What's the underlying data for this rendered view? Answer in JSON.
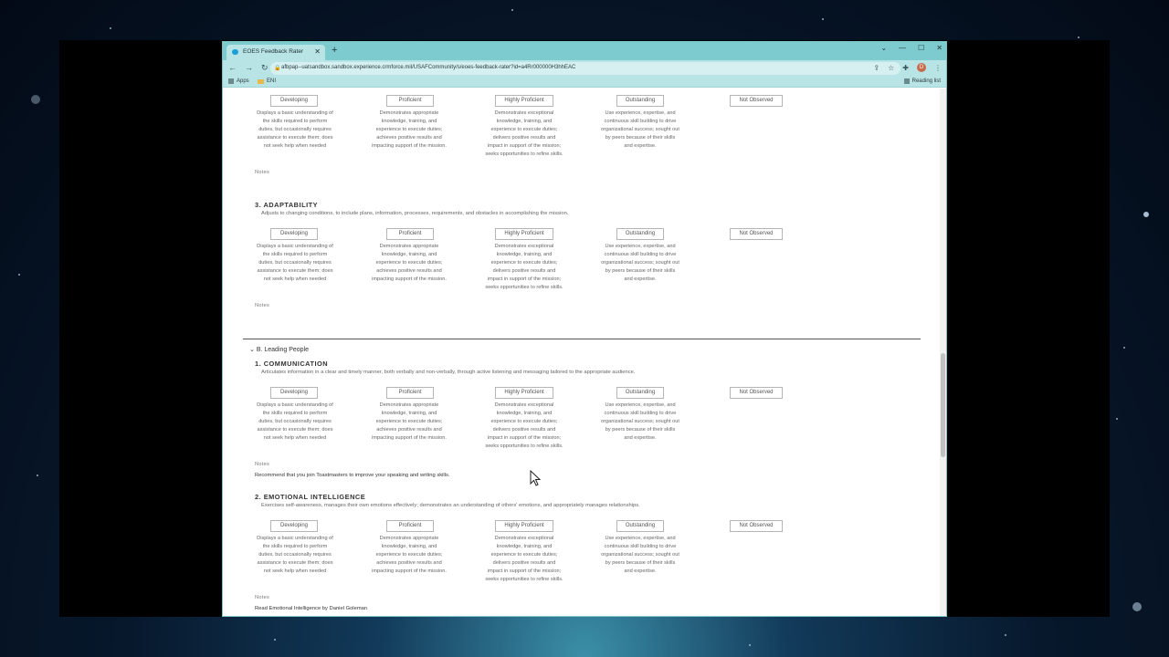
{
  "browser": {
    "tab_title": "EOES Feedback Rater",
    "url": "afbpap--uatsandbox.sandbox.experience.crmforce.mil/USAFCommunity/s/eoes-feedback-rater?id=a4Rr000000H3hhEAC",
    "bookmarks": [
      "Apps",
      "ENI"
    ],
    "reading_list": "Reading list",
    "avatar_letter": "D"
  },
  "rating_options": [
    "Developing",
    "Proficient",
    "Highly Proficient",
    "Outstanding",
    "Not Observed"
  ],
  "rating_descriptions": [
    "Displays a basic understanding of the skills required to perform duties, but occasionally requires assistance to execute them; does not seek help when needed",
    "Demonstrates appropriate knowledge, training, and experience to execute duties; achieves positive results and impacting support of the mission.",
    "Demonstrates exceptional knowledge, training, and experience to execute duties; delivers positive results and impact in support of the mission; seeks opportunities to refine skills.",
    "Use experience, expertise, and continuous skill building to drive organizational success; sought out by peers because of their skills and expertise."
  ],
  "notes_label": "Notes",
  "adaptability": {
    "title": "3. ADAPTABILITY",
    "description": "Adjusts to changing conditions, to include plans, information, processes, requirements, and obstacles in accomplishing the mission."
  },
  "section_b": {
    "title": "B. Leading People",
    "communication": {
      "title": "1. COMMUNICATION",
      "description": "Articulates information in a clear and timely manner, both verbally and non-verbally, through active listening and messaging tailored to the appropriate audience.",
      "note": "Recommend that you join Toastmasters to improve your speaking and writing skills."
    },
    "emotional": {
      "title": "2. EMOTIONAL INTELLIGENCE",
      "description": "Exercises self-awareness, manages their own emotions effectively; demonstrates an understanding of others' emotions, and appropriately manages relationships.",
      "note": "Read Emotional Intelligence by Daniel Goleman"
    }
  }
}
